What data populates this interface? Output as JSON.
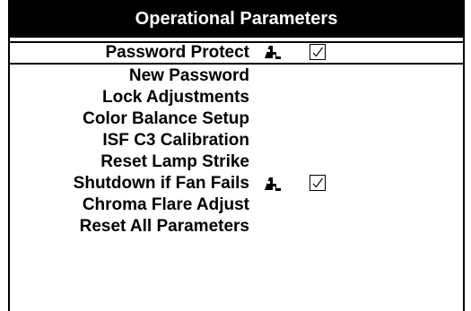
{
  "window": {
    "title": "Operational Parameters"
  },
  "menu": {
    "items": [
      {
        "label": "Password Protect",
        "locked": true,
        "checked": true,
        "selected": true
      },
      {
        "label": "New Password",
        "locked": false,
        "checked": null,
        "selected": false
      },
      {
        "label": "Lock Adjustments",
        "locked": false,
        "checked": null,
        "selected": false
      },
      {
        "label": "Color Balance Setup",
        "locked": false,
        "checked": null,
        "selected": false
      },
      {
        "label": "ISF C3 Calibration",
        "locked": false,
        "checked": null,
        "selected": false
      },
      {
        "label": "Reset Lamp Strike",
        "locked": false,
        "checked": null,
        "selected": false
      },
      {
        "label": "Shutdown if Fan Fails",
        "locked": true,
        "checked": true,
        "selected": false
      },
      {
        "label": "Chroma Flare Adjust",
        "locked": false,
        "checked": null,
        "selected": false
      },
      {
        "label": "Reset All Parameters",
        "locked": false,
        "checked": null,
        "selected": false
      }
    ]
  },
  "icons": {
    "lock": "lock-icon",
    "check": "check-icon"
  },
  "colors": {
    "title_background": "#000000",
    "title_text": "#ffffff",
    "text": "#000000",
    "background": "#ffffff"
  }
}
